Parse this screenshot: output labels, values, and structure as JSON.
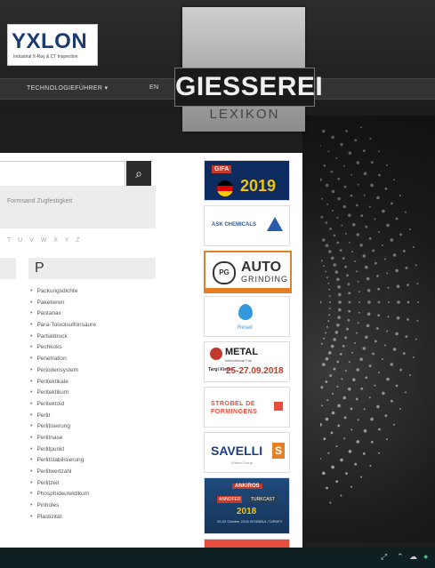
{
  "header": {
    "yxlon_brand": "YXLON",
    "yxlon_tagline": "Industrial X-Ray & CT Inspection",
    "nav_technology": "TECHNOLOGIEFÜHRER ▾",
    "nav_lang": "EN",
    "logo_title": "GIESSEREI",
    "logo_subtitle": "LEXIKON"
  },
  "search": {
    "placeholder": "",
    "button_icon": "search-icon",
    "related_terms": "Formsand  Zugfestigkeit"
  },
  "alphabet": "T U V W X Y Z",
  "section": {
    "letter": "P",
    "terms": [
      "Packungsdichte",
      "Paketieren",
      "Pantanax",
      "Para-Toluolsulfonsäure",
      "Partialdruck",
      "Pechkoks",
      "Penetration",
      "Periodensystem",
      "Peritektikale",
      "Peritektikum",
      "Peritektoid",
      "Perlit",
      "Perlitisierung",
      "Perlitnase",
      "Perlitpunkt",
      "Perlitstabilisierung",
      "Perlitwertzahl",
      "Perlitzeit",
      "Phosphideutektikum",
      "Pinholes",
      "Plastizität"
    ]
  },
  "ads": {
    "gifa": {
      "tag": "GIFA",
      "year": "2019"
    },
    "ask": {
      "name": "ASK CHEMICALS"
    },
    "auto": {
      "badge": "PG",
      "line1": "AUTO",
      "line2": "GRINDING"
    },
    "drop": {
      "name": "Reseil"
    },
    "metal": {
      "name": "METAL",
      "sub": "International Fair",
      "city": "Targi Kielce",
      "dates": "25-27.09.2018"
    },
    "strobel": {
      "line1": "STROBEL DE",
      "line2": "FORMINGENS"
    },
    "savelli": {
      "name": "SAVELLI",
      "mark": "S",
      "sub": "Kühne Group"
    },
    "ankiros": {
      "top": "ANKIROS",
      "left": "ANNOFER",
      "right": "TURKCAST",
      "year": "2018",
      "dates": "20-22 October 2018 ISTANBUL-TURKEY"
    }
  },
  "taskbar": {
    "tray_icons": [
      "network-icon",
      "chevron-up-icon",
      "cloud-icon"
    ]
  },
  "colors": {
    "accent_orange": "#e67e22",
    "gifa_navy": "#0d2b5e",
    "savelli_blue": "#1e3f7a"
  }
}
